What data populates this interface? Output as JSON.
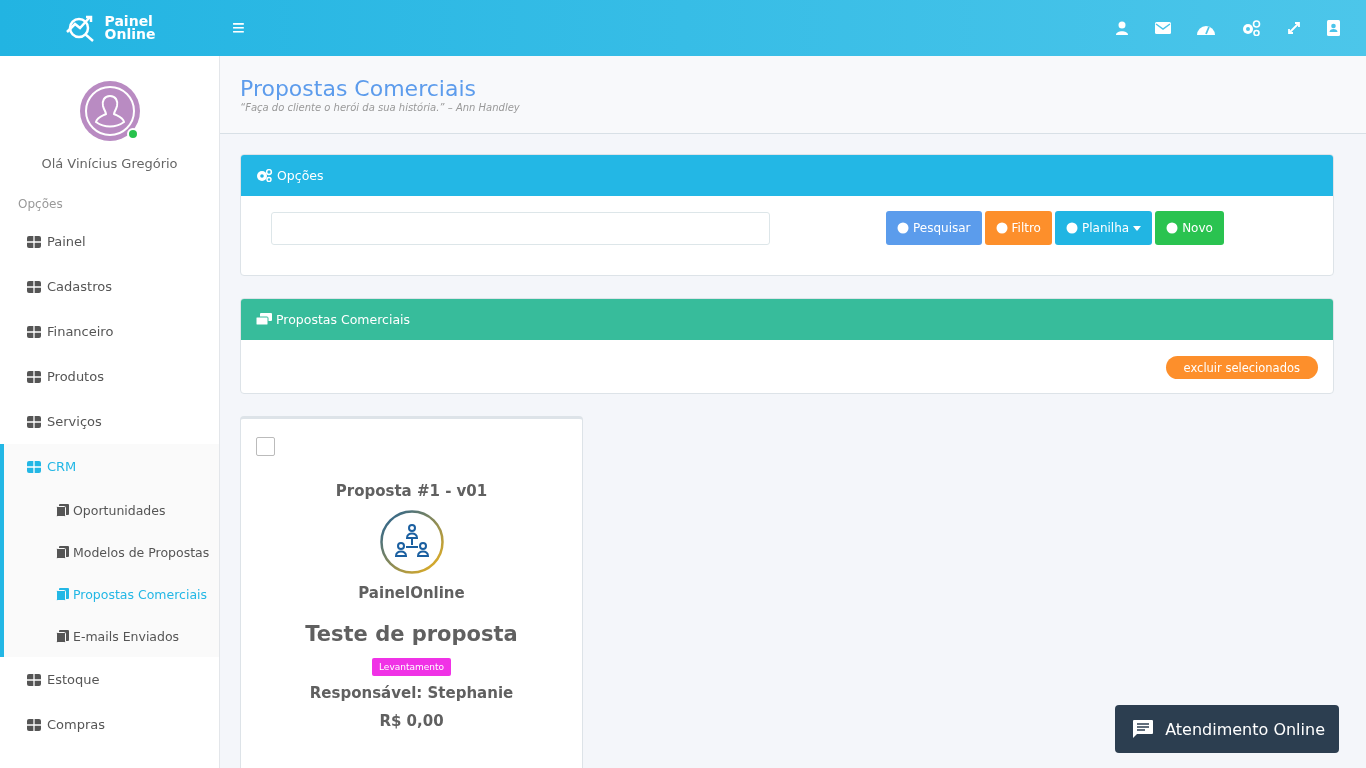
{
  "topbar": {
    "logo_line1": "Painel",
    "logo_line2": "Online",
    "menu_glyph": "≡"
  },
  "user": {
    "greeting": "Olá Vinícius Gregório",
    "online": true
  },
  "sidebar": {
    "heading": "Opções",
    "items": [
      {
        "label": "Painel",
        "selected": false,
        "expanded": false
      },
      {
        "label": "Cadastros",
        "selected": false,
        "expanded": false
      },
      {
        "label": "Financeiro",
        "selected": false,
        "expanded": false
      },
      {
        "label": "Produtos",
        "selected": false,
        "expanded": false
      },
      {
        "label": "Serviços",
        "selected": false,
        "expanded": false
      },
      {
        "label": "CRM",
        "selected": true,
        "expanded": true,
        "children": [
          {
            "label": "Oportunidades",
            "selected": false
          },
          {
            "label": "Modelos de Propostas",
            "selected": false
          },
          {
            "label": "Propostas Comerciais",
            "selected": true
          },
          {
            "label": "E-mails Enviados",
            "selected": false
          }
        ]
      },
      {
        "label": "Estoque",
        "selected": false,
        "expanded": false
      },
      {
        "label": "Compras",
        "selected": false,
        "expanded": false
      }
    ]
  },
  "page": {
    "title": "Propostas Comerciais",
    "quote": "“Faça do cliente o herói da sua história.” – Ann Handley"
  },
  "options_panel": {
    "title": "Opções",
    "buttons": [
      {
        "label": "Pesquisar",
        "color": "#5b9cec",
        "dropdown": false
      },
      {
        "label": "Filtro",
        "color": "#fd8f2b",
        "dropdown": false
      },
      {
        "label": "Planilha",
        "color": "#21b5e3",
        "dropdown": true
      },
      {
        "label": "Novo",
        "color": "#2ac350",
        "dropdown": false
      }
    ]
  },
  "list_panel": {
    "title": "Propostas Comerciais",
    "delete_button": "excluir selecionados"
  },
  "proposals": [
    {
      "checked": false,
      "number": "Proposta #1 - v01",
      "company": "PainelOnline",
      "name": "Teste de proposta",
      "tag": {
        "label": "Levantamento",
        "color": "#f032e6"
      },
      "responsible": "Responsável: Stephanie",
      "value": "R$ 0,00"
    }
  ],
  "chat_button": "Atendimento Online"
}
